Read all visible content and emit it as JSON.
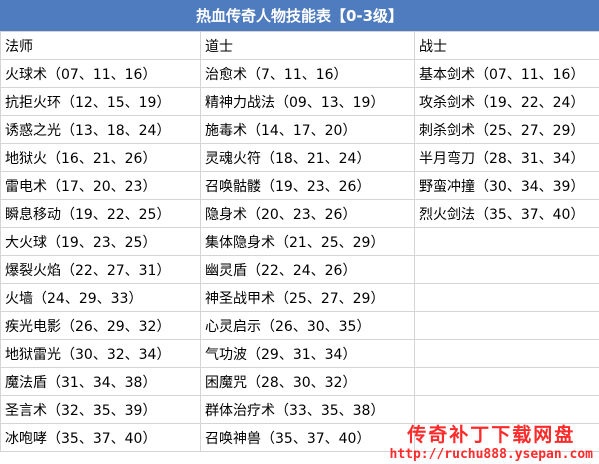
{
  "title": "热血传奇人物技能表【0-3级】",
  "columns": [
    "法师",
    "道士",
    "战士"
  ],
  "rows": [
    [
      "火球术（07、11、16）",
      "治愈术（7、11、16）",
      "基本剑术（07、11、16）"
    ],
    [
      "抗拒火环（12、15、19）",
      "精神力战法（09、13、19）",
      "攻杀剑术（19、22、24）"
    ],
    [
      "诱惑之光（13、18、24）",
      "施毒术（14、17、20）",
      "刺杀剑术（25、27、29）"
    ],
    [
      "地狱火（16、21、26）",
      "灵魂火符（18、21、24）",
      "半月弯刀（28、31、34）"
    ],
    [
      "雷电术（17、20、23）",
      "召唤骷髅（19、23、26）",
      "野蛮冲撞（30、34、39）"
    ],
    [
      "瞬息移动（19、22、25）",
      "隐身术（20、23、26）",
      "烈火剑法（35、37、40）"
    ],
    [
      "大火球（19、23、25）",
      "集体隐身术（21、25、29）",
      ""
    ],
    [
      "爆裂火焰（22、27、31）",
      "幽灵盾（22、24、26）",
      ""
    ],
    [
      "火墙（24、29、33）",
      "神圣战甲术（25、27、29）",
      ""
    ],
    [
      "疾光电影（26、29、32）",
      "心灵启示（26、30、35）",
      ""
    ],
    [
      "地狱雷光（30、32、34）",
      "气功波（29、31、34）",
      ""
    ],
    [
      "魔法盾（31、34、38）",
      "困魔咒（28、30、32）",
      ""
    ],
    [
      "圣言术（32、35、39）",
      "群体治疗术（33、35、38）",
      ""
    ],
    [
      "冰咆哮（35、37、40）",
      "召唤神兽（35、37、40）",
      ""
    ]
  ],
  "watermark": {
    "line1": "传奇补丁下载网盘",
    "line2": "http://ruchu888.ysepan.com"
  },
  "colors": {
    "header_bg": "#4f7cbf",
    "header_text": "#ffffff",
    "grid_line": "#d4d4d4",
    "watermark": "#ff2a2a"
  }
}
